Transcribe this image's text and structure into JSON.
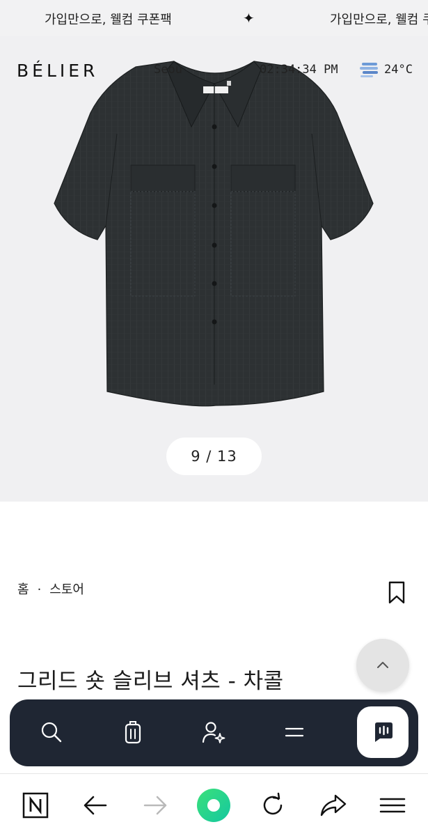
{
  "marquee": {
    "text_1": "가입만으로, 웰컴 쿠폰팩",
    "separator": "✦",
    "text_2": "가입만으로, 웰컴 쿠"
  },
  "header": {
    "logo": "BÉLIER",
    "city": "Seou",
    "time": "02:34:34 PM",
    "weather_icon": "fog-icon",
    "temperature": "24°C"
  },
  "gallery": {
    "current": 9,
    "total": 13,
    "counter_text": "9 / 13"
  },
  "product": {
    "breadcrumb": [
      "홈",
      "스토어"
    ],
    "breadcrumb_separator": "·",
    "title": "그리드 숏 슬리브 셔츠 - 차콜"
  },
  "nav": {
    "items": [
      "search-icon",
      "shopping-bag-icon",
      "user-sparkle-icon",
      "menu-icon",
      "chat-icon"
    ]
  },
  "browser": {
    "items": [
      "naver-n-icon",
      "back-arrow-icon",
      "forward-arrow-icon",
      "green-dot-icon",
      "refresh-icon",
      "share-icon",
      "hamburger-icon"
    ]
  },
  "colors": {
    "nav_bg": "#1f2633",
    "hero_bg": "#f0f0f2",
    "accent_green": "#19d26b"
  }
}
